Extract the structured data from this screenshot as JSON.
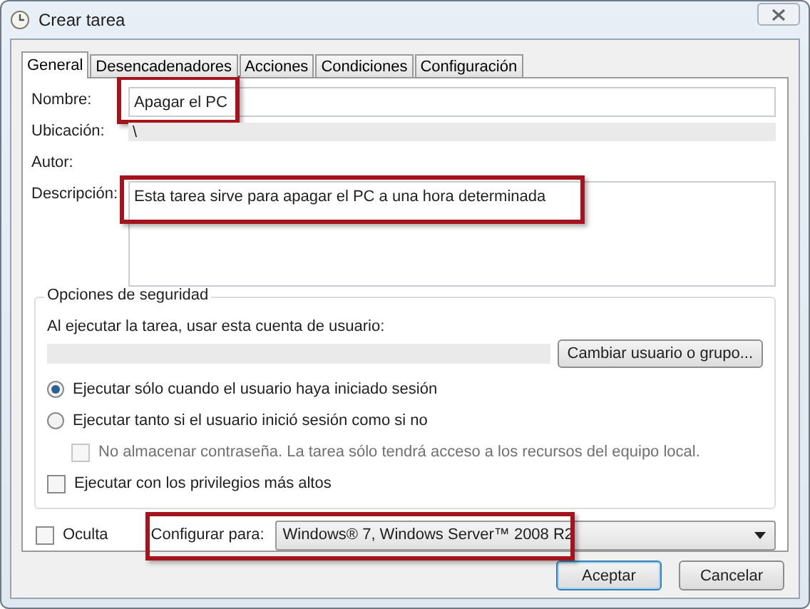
{
  "window": {
    "title": "Crear tarea"
  },
  "tabs": [
    {
      "label": "General",
      "selected": true
    },
    {
      "label": "Desencadenadores",
      "selected": false
    },
    {
      "label": "Acciones",
      "selected": false
    },
    {
      "label": "Condiciones",
      "selected": false
    },
    {
      "label": "Configuración",
      "selected": false
    }
  ],
  "fields": [
    {
      "kind": "text",
      "label": "Nombre:",
      "value": "Apagar el PC",
      "highlighted": true
    },
    {
      "kind": "readonly",
      "label": "Ubicación:",
      "value": "\\",
      "highlighted": false
    },
    {
      "kind": "plain",
      "label": "Autor:",
      "highlighted": false
    },
    {
      "kind": "multiline",
      "label": "Descripción:",
      "value": "Esta tarea sirve para apagar el PC a una hora determinada",
      "highlighted": true
    }
  ],
  "security": {
    "title": "Opciones de seguridad",
    "account_label": "Al ejecutar la tarea, usar esta cuenta de usuario:",
    "change_button": "Cambiar usuario o grupo...",
    "options": [
      {
        "kind": "radio",
        "label": "Ejecutar sólo cuando el usuario haya iniciado sesión",
        "selected": true
      },
      {
        "kind": "radio",
        "label": "Ejecutar tanto si el usuario inició sesión como si no",
        "selected": false,
        "children": [
          {
            "kind": "checkbox",
            "label": "No almacenar contraseña. La tarea sólo tendrá acceso a los recursos del equipo local.",
            "checked": false,
            "disabled": true
          }
        ]
      },
      {
        "kind": "checkbox",
        "label": "Ejecutar con los privilegios más altos",
        "checked": false,
        "disabled": false
      }
    ]
  },
  "hidden": {
    "label": "Oculta",
    "checked": false
  },
  "configure": {
    "label": "Configurar para:",
    "value": "Windows® 7, Windows Server™ 2008 R2",
    "highlighted": true
  },
  "buttons": [
    {
      "label": "Aceptar",
      "default": true
    },
    {
      "label": "Cancelar",
      "default": false
    }
  ]
}
